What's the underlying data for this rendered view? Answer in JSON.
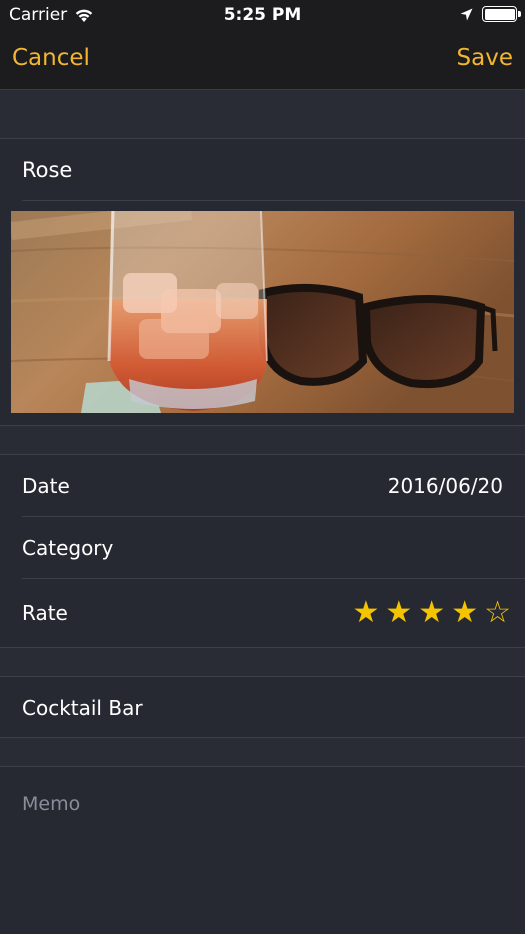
{
  "status_bar": {
    "carrier": "Carrier",
    "time": "5:25 PM",
    "icons": [
      "wifi-icon",
      "location-icon",
      "battery-icon"
    ]
  },
  "nav": {
    "cancel_label": "Cancel",
    "save_label": "Save",
    "accent_color": "#f2b630"
  },
  "title_field": {
    "value": "Rose"
  },
  "photo": {
    "description": "glass-and-sunglasses-photo"
  },
  "details": {
    "date_label": "Date",
    "date_value": "2016/06/20",
    "category_label": "Category",
    "category_value": "",
    "rate_label": "Rate",
    "rating": 4,
    "rating_max": 5,
    "star_color": "#f5c400"
  },
  "place_field": {
    "value": "Cocktail Bar"
  },
  "memo": {
    "placeholder": "Memo",
    "value": ""
  },
  "colors": {
    "background": "#2a2c35",
    "header": "#1c1c1f"
  }
}
